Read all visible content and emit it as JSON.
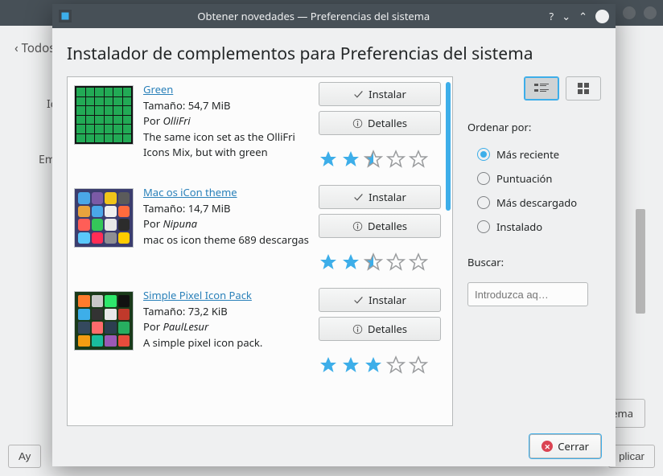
{
  "bg": {
    "back_label": "Todos",
    "left_label1": "Ic",
    "left_label2": "Em",
    "btn_label": "ema",
    "help_label": "Ay",
    "apply_label": "plicar"
  },
  "titlebar": {
    "title": "Obtener novedades — Preferencias del sistema"
  },
  "page_title": "Instalador de complementos para Preferencias del sistema",
  "items": [
    {
      "name": "Green",
      "size": "Tamaño: 54,7 MiB",
      "author_prefix": "Por ",
      "author": "OlliFri",
      "desc": "The same icon set as the OlliFri Icons Mix, but with green",
      "rating": 2.5
    },
    {
      "name": "Mac os iCon theme",
      "size": "Tamaño: 14,7 MiB",
      "author_prefix": "Por ",
      "author": "Nipuna",
      "desc": "mac os icon theme 689 descargas",
      "rating": 2.5
    },
    {
      "name": "Simple Pixel Icon Pack",
      "size": "Tamaño: 73,2 KiB",
      "author_prefix": "Por ",
      "author": "PaulLesur",
      "desc": "A simple pixel icon pack.",
      "rating": 3
    }
  ],
  "buttons": {
    "install": "Instalar",
    "details": "Detalles",
    "close": "Cerrar"
  },
  "sort": {
    "label": "Ordenar por:",
    "options": [
      "Más reciente",
      "Puntuación",
      "Más descargado",
      "Instalado"
    ],
    "selected": 0
  },
  "search": {
    "label": "Buscar:",
    "placeholder": "Introduzca aq…"
  }
}
